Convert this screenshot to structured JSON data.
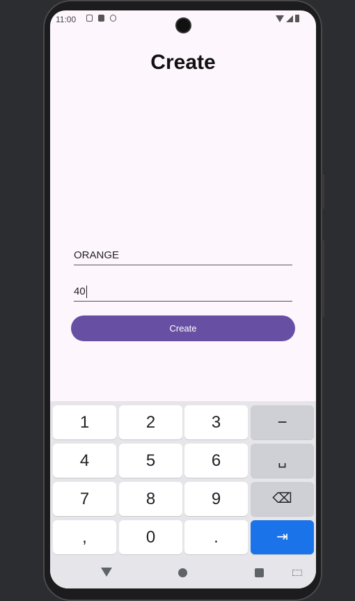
{
  "status_bar": {
    "time": "11:00"
  },
  "page": {
    "title": "Create"
  },
  "form": {
    "name_value": "ORANGE",
    "quantity_value": "40",
    "submit_label": "Create"
  },
  "keyboard": {
    "keys": [
      "1",
      "2",
      "3",
      "−",
      "4",
      "5",
      "6",
      "␣",
      "7",
      "8",
      "9",
      "⌫",
      ",",
      "0",
      ".",
      "⇥"
    ]
  },
  "nav_bar": {
    "icons": [
      "back-icon",
      "home-icon",
      "recents-icon",
      "keyboard-switch-icon"
    ]
  }
}
